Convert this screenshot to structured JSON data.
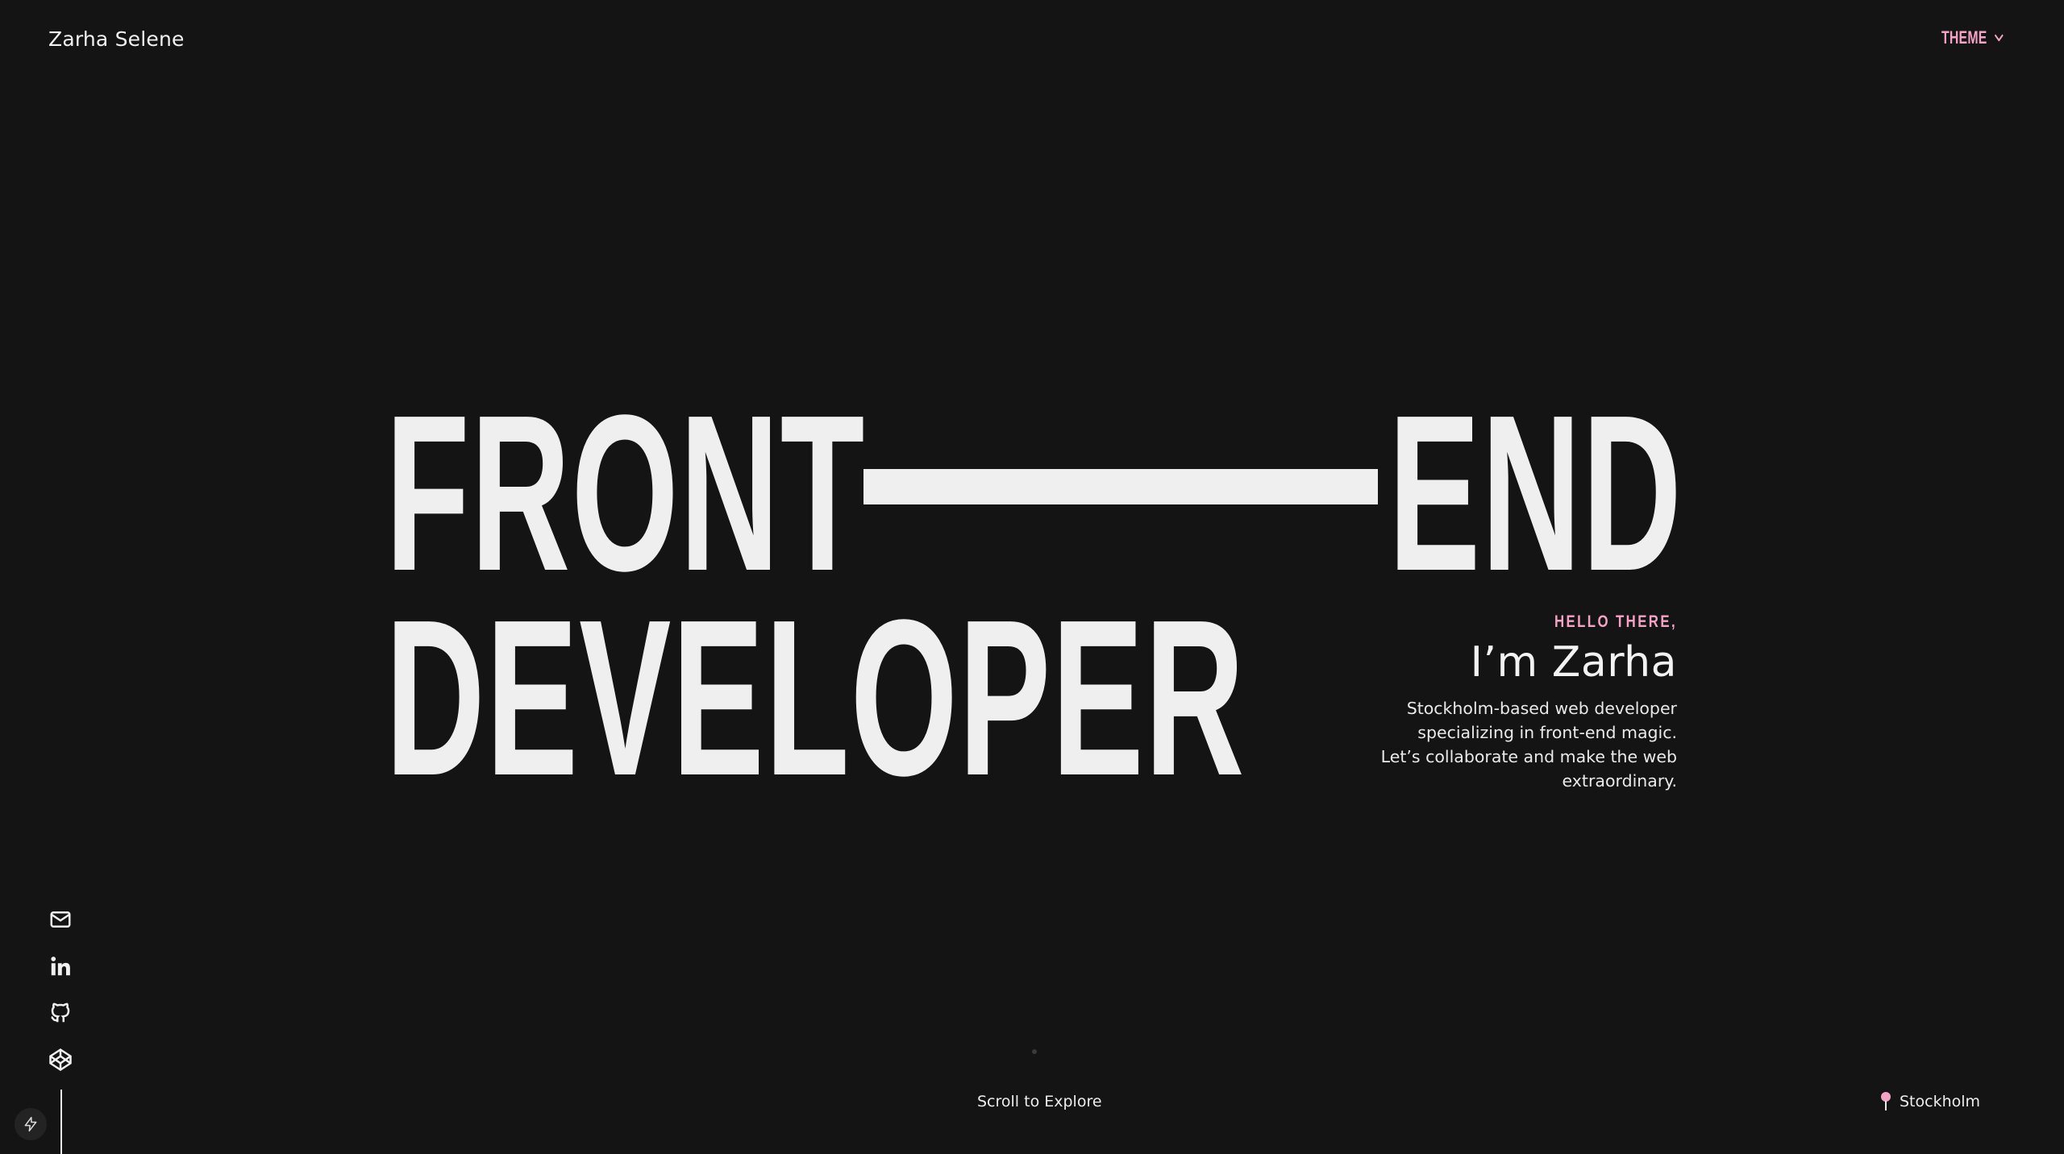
{
  "header": {
    "brand": "Zarha Selene",
    "theme_label": "THEME",
    "theme_icon": "chevron-down-icon"
  },
  "hero": {
    "line1_left": "FRONT",
    "line1_right": "END",
    "line2": "DEVELOPER"
  },
  "intro": {
    "greeting": "HELLO THERE,",
    "name": "I’m Zarha",
    "description_lines": [
      "Stockholm-based web developer",
      "specializing in front-end magic.",
      "Let’s collaborate and make the web",
      "extraordinary."
    ]
  },
  "socials": [
    {
      "icon": "mail-icon"
    },
    {
      "icon": "linkedin-icon"
    },
    {
      "icon": "github-icon"
    },
    {
      "icon": "codepen-icon"
    }
  ],
  "footer": {
    "scroll_hint": "Scroll to Explore",
    "location": "Stockholm",
    "location_icon": "map-pin-icon",
    "bolt_icon": "lightning-icon"
  },
  "colors": {
    "background": "#141414",
    "text": "#efefef",
    "accent": "#f4a3c4"
  }
}
